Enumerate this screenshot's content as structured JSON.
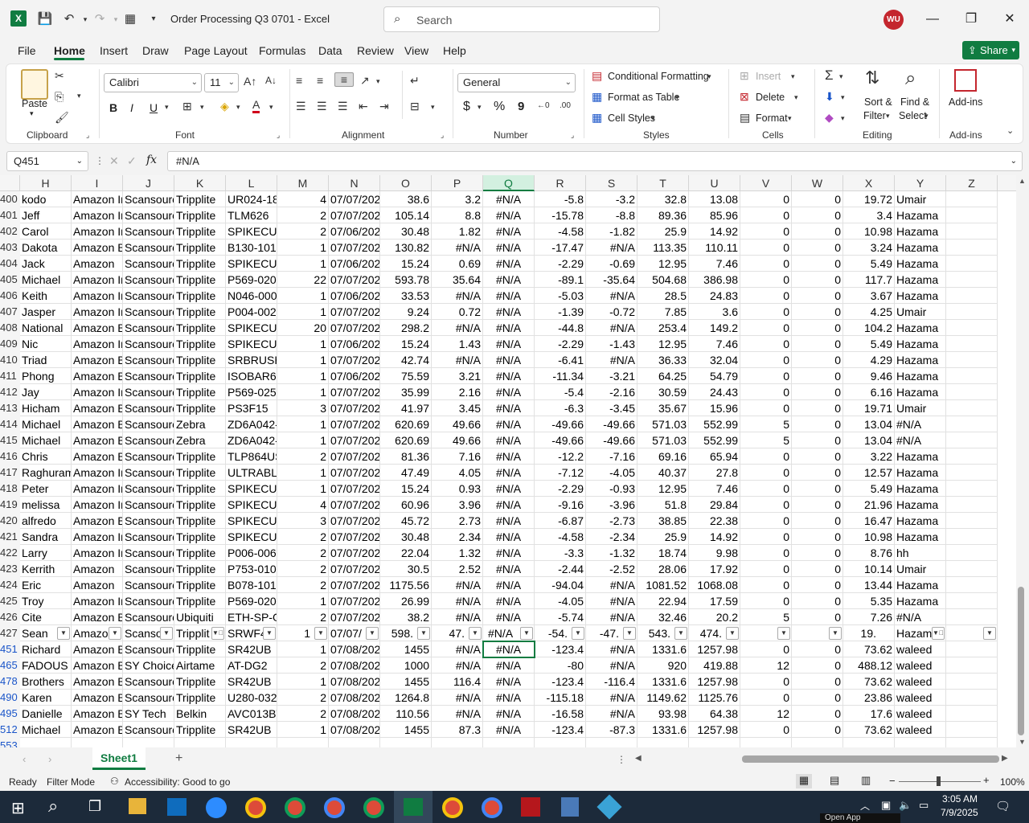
{
  "window": {
    "title": "Order Processing Q3 0701  -  Excel",
    "search_placeholder": "Search",
    "avatar_initials": "WU",
    "minimize": "—",
    "maximize": "❐",
    "close": "✕"
  },
  "tabs": [
    "File",
    "Home",
    "Insert",
    "Draw",
    "Page Layout",
    "Formulas",
    "Data",
    "Review",
    "View",
    "Help"
  ],
  "active_tab": "Home",
  "share_label": "Share",
  "ribbon": {
    "clipboard": {
      "paste": "Paste",
      "label": "Clipboard"
    },
    "font": {
      "name": "Calibri",
      "size": "11",
      "label": "Font",
      "bold": "B",
      "italic": "I",
      "underline": "U"
    },
    "alignment": {
      "label": "Alignment"
    },
    "number": {
      "format": "General",
      "label": "Number",
      "currency": "$",
      "percent": "%",
      "comma": "9"
    },
    "styles": {
      "conditional": "Conditional Formatting",
      "format_table": "Format as Table",
      "cell_styles": "Cell Styles",
      "label": "Styles"
    },
    "cells": {
      "insert": "Insert",
      "delete": "Delete",
      "format": "Format",
      "label": "Cells"
    },
    "editing": {
      "sort": "Sort &",
      "sort2": "Filter",
      "find": "Find &",
      "find2": "Select",
      "label": "Editing"
    },
    "addins": {
      "button": "Add-ins",
      "label": "Add-ins"
    }
  },
  "formula_bar": {
    "name_box": "Q451",
    "fx": "fx",
    "value": "#N/A"
  },
  "columns": [
    "H",
    "I",
    "J",
    "K",
    "L",
    "M",
    "N",
    "O",
    "P",
    "Q",
    "R",
    "S",
    "T",
    "U",
    "V",
    "W",
    "X",
    "Y",
    "Z"
  ],
  "selected_column": "Q",
  "rows": [
    {
      "n": "400",
      "c": [
        "kodo",
        "Amazon Ir",
        "Scansourc",
        "Tripplite",
        "UR024-18I",
        "4",
        "07/07/202",
        "38.6",
        "3.2",
        "#N/A",
        "-5.8",
        "-3.2",
        "32.8",
        "13.08",
        "0",
        "0",
        "19.72",
        "Umair",
        ""
      ]
    },
    {
      "n": "401",
      "c": [
        "Jeff",
        "Amazon Ir",
        "Scansourc",
        "Tripplite",
        "TLM626",
        "2",
        "07/07/202",
        "105.14",
        "8.8",
        "#N/A",
        "-15.78",
        "-8.8",
        "89.36",
        "85.96",
        "0",
        "0",
        "3.4",
        "Hazama",
        ""
      ]
    },
    {
      "n": "402",
      "c": [
        "Carol",
        "Amazon Ir",
        "Scansourc",
        "Tripplite",
        "SPIKECUBI",
        "2",
        "07/06/202",
        "30.48",
        "1.82",
        "#N/A",
        "-4.58",
        "-1.82",
        "25.9",
        "14.92",
        "0",
        "0",
        "10.98",
        "Hazama",
        ""
      ]
    },
    {
      "n": "403",
      "c": [
        "Dakota",
        "Amazon B",
        "Scansourc",
        "Tripplite",
        "B130-101-",
        "1",
        "07/07/202",
        "130.82",
        "#N/A",
        "#N/A",
        "-17.47",
        "#N/A",
        "113.35",
        "110.11",
        "0",
        "0",
        "3.24",
        "Hazama",
        ""
      ]
    },
    {
      "n": "404",
      "c": [
        "Jack",
        "Amazon",
        "Scansourc",
        "Tripplite",
        "SPIKECUBI",
        "1",
        "07/06/202",
        "15.24",
        "0.69",
        "#N/A",
        "-2.29",
        "-0.69",
        "12.95",
        "7.46",
        "0",
        "0",
        "5.49",
        "Hazama",
        ""
      ]
    },
    {
      "n": "405",
      "c": [
        "Michael",
        "Amazon Ir",
        "Scansourc",
        "Tripplite",
        "P569-020",
        "22",
        "07/07/202",
        "593.78",
        "35.64",
        "#N/A",
        "-89.1",
        "-35.64",
        "504.68",
        "386.98",
        "0",
        "0",
        "117.7",
        "Hazama",
        ""
      ]
    },
    {
      "n": "406",
      "c": [
        "Keith",
        "Amazon Ir",
        "Scansourc",
        "Tripplite",
        "N046-000",
        "1",
        "07/06/202",
        "33.53",
        "#N/A",
        "#N/A",
        "-5.03",
        "#N/A",
        "28.5",
        "24.83",
        "0",
        "0",
        "3.67",
        "Hazama",
        ""
      ]
    },
    {
      "n": "407",
      "c": [
        "Jasper",
        "Amazon Ir",
        "Scansourc",
        "Tripplite",
        "P004-002-",
        "1",
        "07/07/202",
        "9.24",
        "0.72",
        "#N/A",
        "-1.39",
        "-0.72",
        "7.85",
        "3.6",
        "0",
        "0",
        "4.25",
        "Umair",
        ""
      ]
    },
    {
      "n": "408",
      "c": [
        "National",
        "Amazon B",
        "Scansourc",
        "Tripplite",
        "SPIKECUBI",
        "20",
        "07/07/202",
        "298.2",
        "#N/A",
        "#N/A",
        "-44.8",
        "#N/A",
        "253.4",
        "149.2",
        "0",
        "0",
        "104.2",
        "Hazama",
        ""
      ]
    },
    {
      "n": "409",
      "c": [
        "Nic",
        "Amazon Ir",
        "Scansourc",
        "Tripplite",
        "SPIKECUBI",
        "1",
        "07/06/202",
        "15.24",
        "1.43",
        "#N/A",
        "-2.29",
        "-1.43",
        "12.95",
        "7.46",
        "0",
        "0",
        "5.49",
        "Hazama",
        ""
      ]
    },
    {
      "n": "410",
      "c": [
        "Triad",
        "Amazon B",
        "Scansourc",
        "Tripplite",
        "SRBRUSHV",
        "1",
        "07/07/202",
        "42.74",
        "#N/A",
        "#N/A",
        "-6.41",
        "#N/A",
        "36.33",
        "32.04",
        "0",
        "0",
        "4.29",
        "Hazama",
        ""
      ]
    },
    {
      "n": "411",
      "c": [
        "Phong",
        "Amazon B",
        "Scansourc",
        "Tripplite",
        "ISOBAR6D",
        "1",
        "07/06/202",
        "75.59",
        "3.21",
        "#N/A",
        "-11.34",
        "-3.21",
        "64.25",
        "54.79",
        "0",
        "0",
        "9.46",
        "Hazama",
        ""
      ]
    },
    {
      "n": "412",
      "c": [
        "Jay",
        "Amazon Ir",
        "Scansourc",
        "Tripplite",
        "P569-025",
        "1",
        "07/07/202",
        "35.99",
        "2.16",
        "#N/A",
        "-5.4",
        "-2.16",
        "30.59",
        "24.43",
        "0",
        "0",
        "6.16",
        "Hazama",
        ""
      ]
    },
    {
      "n": "413",
      "c": [
        "Hicham",
        "Amazon B",
        "Scansourc",
        "Tripplite",
        "PS3F15",
        "3",
        "07/07/202",
        "41.97",
        "3.45",
        "#N/A",
        "-6.3",
        "-3.45",
        "35.67",
        "15.96",
        "0",
        "0",
        "19.71",
        "Umair",
        ""
      ]
    },
    {
      "n": "414",
      "c": [
        "Michael",
        "Amazon B",
        "Scansourc",
        "Zebra",
        "ZD6A042-I",
        "1",
        "07/07/202",
        "620.69",
        "49.66",
        "#N/A",
        "-49.66",
        "-49.66",
        "571.03",
        "552.99",
        "5",
        "0",
        "13.04",
        "#N/A",
        ""
      ]
    },
    {
      "n": "415",
      "c": [
        "Michael",
        "Amazon B",
        "Scansourc",
        "Zebra",
        "ZD6A042-I",
        "1",
        "07/07/202",
        "620.69",
        "49.66",
        "#N/A",
        "-49.66",
        "-49.66",
        "571.03",
        "552.99",
        "5",
        "0",
        "13.04",
        "#N/A",
        ""
      ]
    },
    {
      "n": "416",
      "c": [
        "Chris",
        "Amazon B",
        "Scansourc",
        "Tripplite",
        "TLP864USI",
        "2",
        "07/07/202",
        "81.36",
        "7.16",
        "#N/A",
        "-12.2",
        "-7.16",
        "69.16",
        "65.94",
        "0",
        "0",
        "3.22",
        "Hazama",
        ""
      ]
    },
    {
      "n": "417",
      "c": [
        "Raghuram",
        "Amazon Ir",
        "Scansourc",
        "Tripplite",
        "ULTRABLC",
        "1",
        "07/07/202",
        "47.49",
        "4.05",
        "#N/A",
        "-7.12",
        "-4.05",
        "40.37",
        "27.8",
        "0",
        "0",
        "12.57",
        "Hazama",
        ""
      ]
    },
    {
      "n": "418",
      "c": [
        "Peter",
        "Amazon Ir",
        "Scansourc",
        "Tripplite",
        "SPIKECUBI",
        "1",
        "07/07/202",
        "15.24",
        "0.93",
        "#N/A",
        "-2.29",
        "-0.93",
        "12.95",
        "7.46",
        "0",
        "0",
        "5.49",
        "Hazama",
        ""
      ]
    },
    {
      "n": "419",
      "c": [
        "melissa",
        "Amazon Ir",
        "Scansourc",
        "Tripplite",
        "SPIKECUBI",
        "4",
        "07/07/202",
        "60.96",
        "3.96",
        "#N/A",
        "-9.16",
        "-3.96",
        "51.8",
        "29.84",
        "0",
        "0",
        "21.96",
        "Hazama",
        ""
      ]
    },
    {
      "n": "420",
      "c": [
        "alfredo",
        "Amazon B",
        "Scansourc",
        "Tripplite",
        "SPIKECUBI",
        "3",
        "07/07/202",
        "45.72",
        "2.73",
        "#N/A",
        "-6.87",
        "-2.73",
        "38.85",
        "22.38",
        "0",
        "0",
        "16.47",
        "Hazama",
        ""
      ]
    },
    {
      "n": "421",
      "c": [
        "Sandra",
        "Amazon Ir",
        "Scansourc",
        "Tripplite",
        "SPIKECUBI",
        "2",
        "07/07/202",
        "30.48",
        "2.34",
        "#N/A",
        "-4.58",
        "-2.34",
        "25.9",
        "14.92",
        "0",
        "0",
        "10.98",
        "Hazama",
        ""
      ]
    },
    {
      "n": "422",
      "c": [
        "Larry",
        "Amazon Ir",
        "Scansourc",
        "Tripplite",
        "P006-006-",
        "2",
        "07/07/202",
        "22.04",
        "1.32",
        "#N/A",
        "-3.3",
        "-1.32",
        "18.74",
        "9.98",
        "0",
        "0",
        "8.76",
        "hh",
        ""
      ]
    },
    {
      "n": "423",
      "c": [
        "Kerrith",
        "Amazon",
        "Scansourc",
        "Tripplite",
        "P753-010",
        "2",
        "07/07/202",
        "30.5",
        "2.52",
        "#N/A",
        "-2.44",
        "-2.52",
        "28.06",
        "17.92",
        "0",
        "0",
        "10.14",
        "Umair",
        ""
      ]
    },
    {
      "n": "424",
      "c": [
        "Eric",
        "Amazon",
        "Scansourc",
        "Tripplite",
        "B078-101-",
        "2",
        "07/07/202",
        "1175.56",
        "#N/A",
        "#N/A",
        "-94.04",
        "#N/A",
        "1081.52",
        "1068.08",
        "0",
        "0",
        "13.44",
        "Hazama",
        ""
      ]
    },
    {
      "n": "425",
      "c": [
        "Troy",
        "Amazon Ir",
        "Scansourc",
        "Tripplite",
        "P569-020",
        "1",
        "07/07/202",
        "26.99",
        "#N/A",
        "#N/A",
        "-4.05",
        "#N/A",
        "22.94",
        "17.59",
        "0",
        "0",
        "5.35",
        "Hazama",
        ""
      ]
    },
    {
      "n": "426",
      "c": [
        "Cite",
        "Amazon B",
        "Scansourc",
        "Ubiquiti",
        "ETH-SP-G2",
        "2",
        "07/07/202",
        "38.2",
        "#N/A",
        "#N/A",
        "-5.74",
        "#N/A",
        "32.46",
        "20.2",
        "5",
        "0",
        "7.26",
        "#N/A",
        ""
      ]
    },
    {
      "n": "427",
      "header": true,
      "c": [
        "Sean",
        "Amazo",
        "Scanso",
        "Tripplit",
        "SRWF4(",
        "1",
        "07/07/",
        "598.",
        "47.",
        "#N/A",
        "-54.",
        "-47.",
        "543.",
        "474.",
        "",
        "",
        "19.",
        "Hazama",
        ""
      ]
    },
    {
      "n": "451",
      "blue": true,
      "c": [
        "Richard",
        "Amazon B",
        "Scansourc",
        "Tripplite",
        "SR42UB",
        "1",
        "07/08/202",
        "1455",
        "#N/A",
        "#N/A",
        "-123.4",
        "#N/A",
        "1331.6",
        "1257.98",
        "0",
        "0",
        "73.62",
        "waleed",
        ""
      ]
    },
    {
      "n": "465",
      "blue": true,
      "c": [
        "FADOUS",
        "Amazon B",
        "SY Choice",
        "Airtame",
        "AT-DG2",
        "2",
        "07/08/202",
        "1000",
        "#N/A",
        "#N/A",
        "-80",
        "#N/A",
        "920",
        "419.88",
        "12",
        "0",
        "488.12",
        "waleed",
        ""
      ]
    },
    {
      "n": "478",
      "blue": true,
      "c": [
        "Brothers",
        "Amazon B",
        "Scansourc",
        "Tripplite",
        "SR42UB",
        "1",
        "07/08/202",
        "1455",
        "116.4",
        "#N/A",
        "-123.4",
        "-116.4",
        "1331.6",
        "1257.98",
        "0",
        "0",
        "73.62",
        "waleed",
        ""
      ]
    },
    {
      "n": "490",
      "blue": true,
      "c": [
        "Karen",
        "Amazon B",
        "Scansourc",
        "Tripplite",
        "U280-032-",
        "2",
        "07/08/202",
        "1264.8",
        "#N/A",
        "#N/A",
        "-115.18",
        "#N/A",
        "1149.62",
        "1125.76",
        "0",
        "0",
        "23.86",
        "waleed",
        ""
      ]
    },
    {
      "n": "495",
      "blue": true,
      "c": [
        "Danielle",
        "Amazon B",
        "SY Tech",
        "Belkin",
        "AVC013BT",
        "2",
        "07/08/202",
        "110.56",
        "#N/A",
        "#N/A",
        "-16.58",
        "#N/A",
        "93.98",
        "64.38",
        "12",
        "0",
        "17.6",
        "waleed",
        ""
      ]
    },
    {
      "n": "512",
      "blue": true,
      "c": [
        "Michael",
        "Amazon B",
        "Scansourc",
        "Tripplite",
        "SR42UB",
        "1",
        "07/08/202",
        "1455",
        "87.3",
        "#N/A",
        "-123.4",
        "-87.3",
        "1331.6",
        "1257.98",
        "0",
        "0",
        "73.62",
        "waleed",
        ""
      ]
    },
    {
      "n": "553",
      "blue": true,
      "c": [
        "",
        "",
        "",
        "",
        "",
        "",
        "",
        "",
        "",
        "",
        "",
        "",
        "",
        "",
        "",
        "",
        "",
        "",
        ""
      ]
    }
  ],
  "sheet_tab": "Sheet1",
  "status": {
    "ready": "Ready",
    "filter": "Filter Mode",
    "accessibility": "Accessibility: Good to go",
    "zoom": "100%"
  },
  "taskbar": {
    "time": "3:05 AM",
    "date": "7/9/2025",
    "open_app": "Open App"
  }
}
